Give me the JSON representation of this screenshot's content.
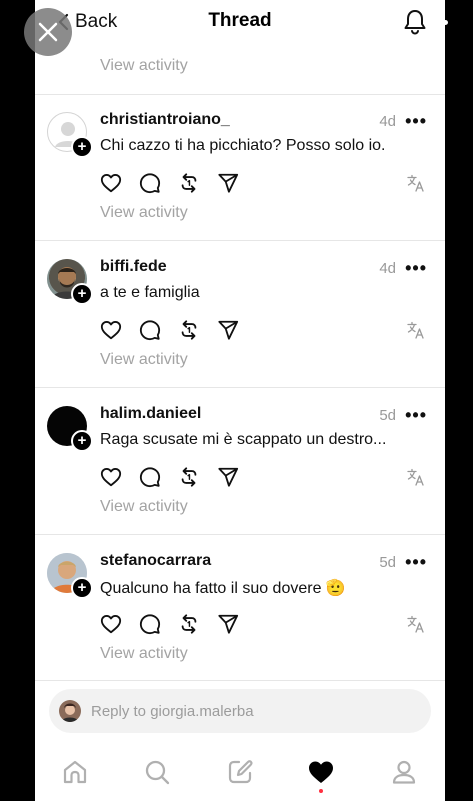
{
  "header": {
    "back_label": "Back",
    "title": "Thread"
  },
  "top_view_activity": "View activity",
  "posts": [
    {
      "username": "christiantroiano_",
      "time": "4d",
      "text": "Chi cazzo ti ha picchiato? Posso solo io.",
      "view_activity": "View activity",
      "avatar": "default-avatar"
    },
    {
      "username": "biffi.fede",
      "time": "4d",
      "text": "a te e famiglia",
      "view_activity": "View activity",
      "avatar": "photo-avatar"
    },
    {
      "username": "halim.danieel",
      "time": "5d",
      "text": "Raga scusate mi è scappato un destro...",
      "view_activity": "View activity",
      "avatar": "black-avatar"
    },
    {
      "username": "stefanocarrara",
      "time": "5d",
      "text": "Qualcuno ha fatto il suo dovere 🫡",
      "view_activity": "View activity",
      "avatar": "photo-avatar"
    }
  ],
  "reply": {
    "placeholder": "Reply to giorgia.malerba"
  },
  "tabs": [
    "home-icon",
    "search-icon",
    "compose-icon",
    "activity-heart-icon",
    "profile-icon"
  ],
  "colors": {
    "secondary_text": "#999999",
    "notification_dot": "#ff3040"
  }
}
